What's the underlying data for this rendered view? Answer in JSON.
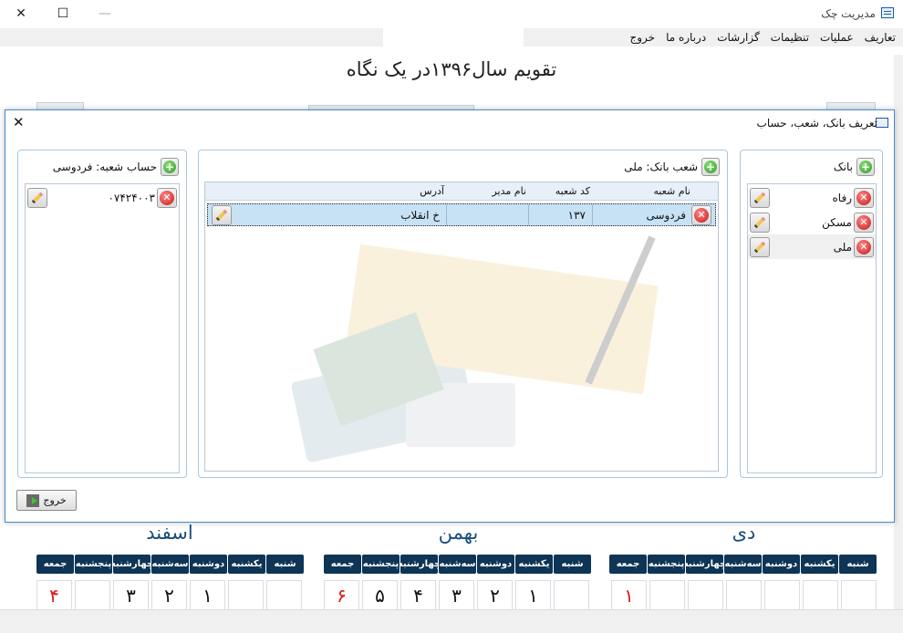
{
  "window": {
    "title": "مدیریت چک",
    "minimize": "—",
    "maximize": "☐",
    "close": "✕"
  },
  "menu": [
    "تعاریف",
    "عملیات",
    "تنظیمات",
    "گزارشات",
    "درباره ما",
    "خروج"
  ],
  "calendar_title": "تقویم سال۱۳۹۶در یک نگاه",
  "dialog": {
    "title": "تعریف بانک، شعب، حساب",
    "close": "✕",
    "bank_panel": {
      "header": "بانک",
      "items": [
        "رفاه",
        "مسکن",
        "ملی"
      ],
      "selected_index": 2
    },
    "branch_panel": {
      "header": "شعب بانک:  ملی",
      "columns": [
        "نام شعبه",
        "کد شعبه",
        "نام مدیر",
        "آدرس"
      ],
      "rows": [
        {
          "name": "فردوسی",
          "code": "۱۳۷",
          "manager": "",
          "address": "خ انقلاب"
        }
      ]
    },
    "account_panel": {
      "header": "حساب شعبه:  فردوسی",
      "items": [
        "۰۷۴۲۴۰۰۳"
      ]
    },
    "exit_label": "خروج"
  },
  "months": [
    {
      "name": "اسفند",
      "weekdays": [
        "شنبه",
        "یکشنبه",
        "دوشنبه",
        "سه‌شنبه",
        "چهارشنبه",
        "پنجشنبه",
        "جمعه"
      ],
      "days": [
        "",
        "",
        "۱",
        "۲",
        "۳",
        "",
        "۴"
      ]
    },
    {
      "name": "بهمن",
      "weekdays": [
        "شنبه",
        "یکشنبه",
        "دوشنبه",
        "سه‌شنبه",
        "چهارشنبه",
        "پنجشنبه",
        "جمعه"
      ],
      "days": [
        "",
        "۱",
        "۲",
        "۳",
        "۴",
        "۵",
        "۶"
      ]
    },
    {
      "name": "دی",
      "weekdays": [
        "شنبه",
        "یکشنبه",
        "دوشنبه",
        "سه‌شنبه",
        "چهارشنبه",
        "پنجشنبه",
        "جمعه"
      ],
      "days": [
        "",
        "",
        "",
        "",
        "",
        "",
        "۱"
      ]
    }
  ],
  "colors": {
    "accent": "#4a8bc9",
    "weekday_header": "#0e3556",
    "friday_red": "#d81818",
    "selection": "#c7e2f5"
  }
}
